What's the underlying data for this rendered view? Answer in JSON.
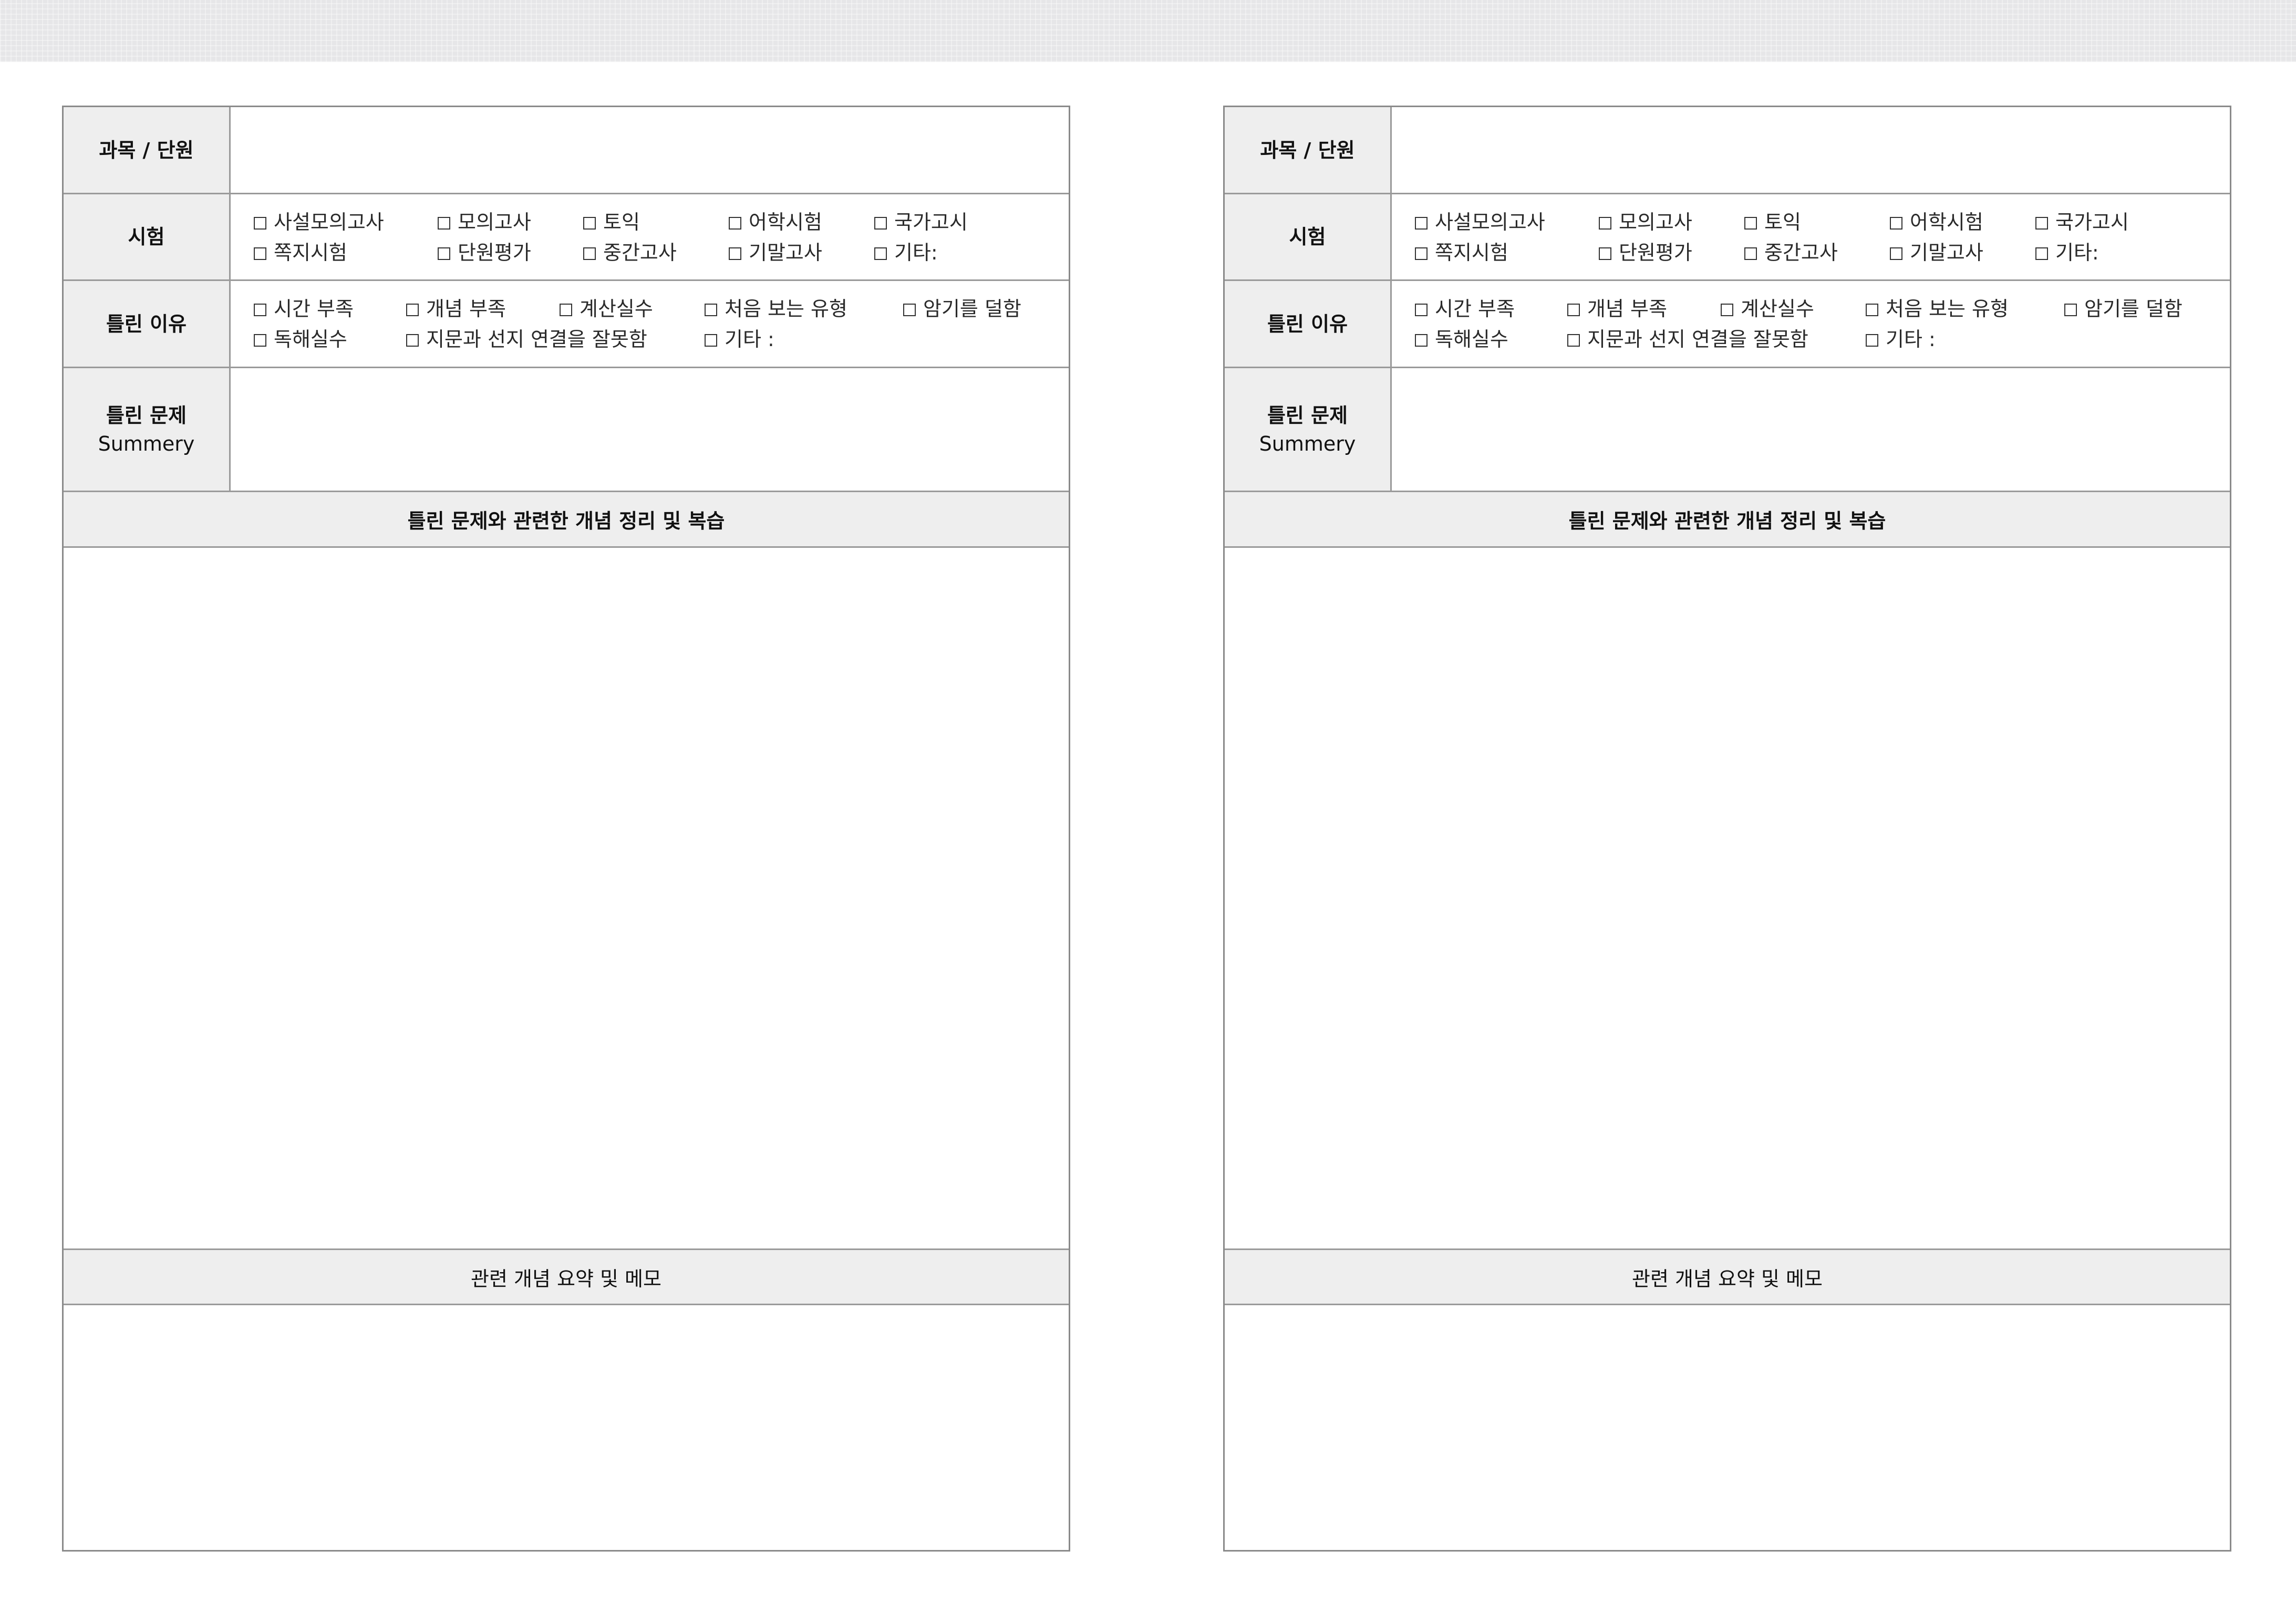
{
  "labels": {
    "subject": "과목 / 단원",
    "exam": "시험",
    "reason": "틀린 이유",
    "summary_line1": "틀린 문제",
    "summary_line2": "Summery",
    "concept_header": "틀린 문제와 관련한 개념 정리 및 복습",
    "memo_header": "관련 개념 요약 및 메모"
  },
  "exam_options": [
    [
      "사설모의고사",
      "모의고사",
      "토익",
      "어학시험",
      "국가고시"
    ],
    [
      "쪽지시험",
      "단원평가",
      "중간고사",
      "기말고사",
      "기타:"
    ]
  ],
  "reason_options": [
    [
      "시간 부족",
      "개념 부족",
      "계산실수",
      "처음 보는 유형",
      "암기를 덜함"
    ],
    [
      "독해실수",
      "지문과 선지 연결을 잘못함",
      "기타 :"
    ]
  ],
  "values": {
    "subject": "",
    "summary": "",
    "concept": "",
    "memo": ""
  }
}
